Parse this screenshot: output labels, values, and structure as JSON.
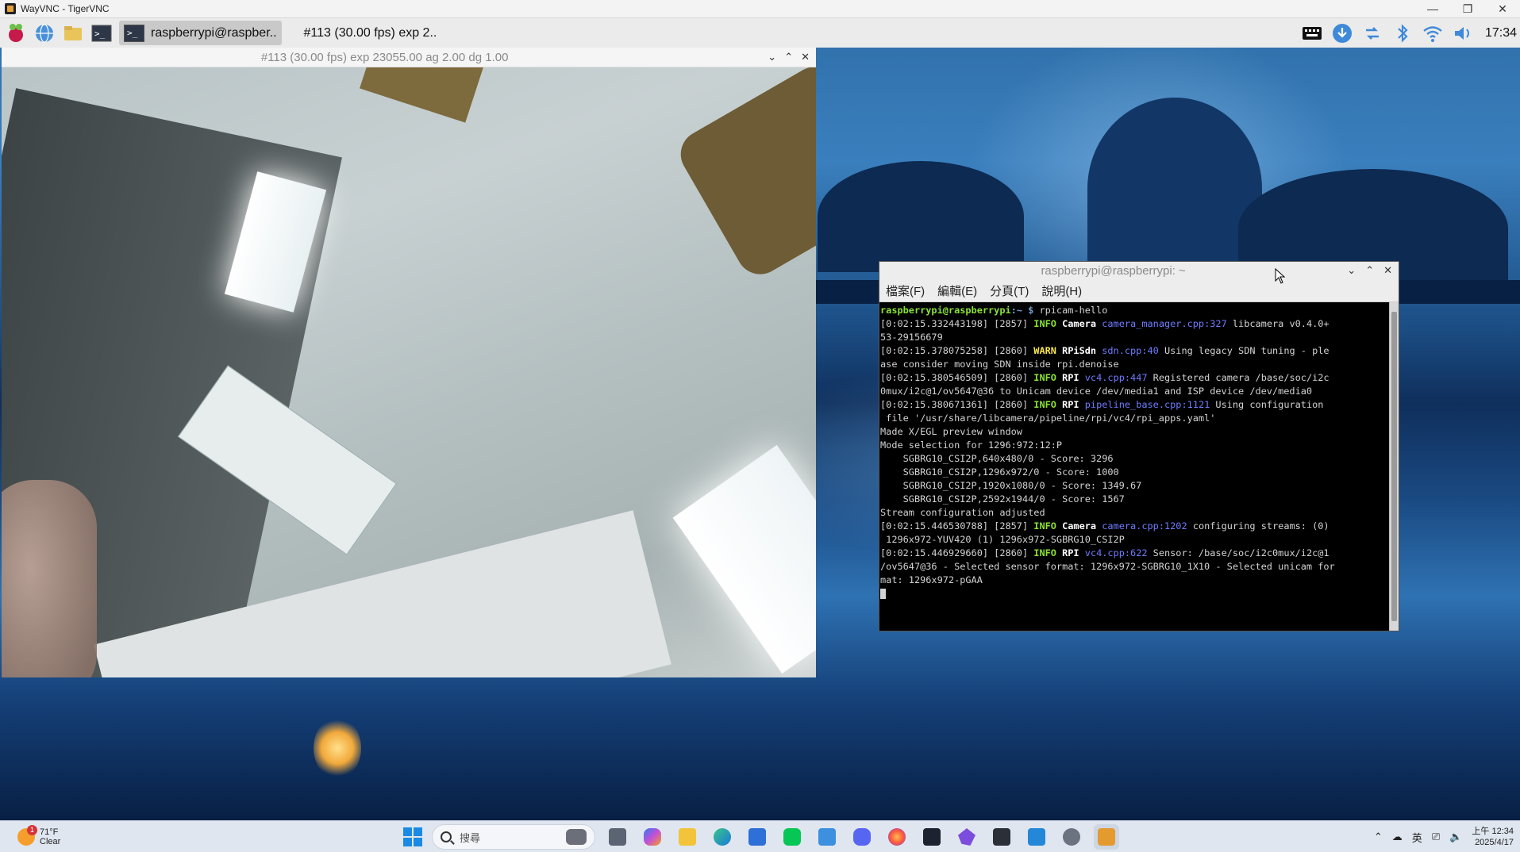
{
  "vnc_window": {
    "title": "WayVNC - TigerVNC",
    "minimize": "—",
    "restore": "❐",
    "close": "✕"
  },
  "rpi_panel": {
    "task_label": "raspberrypi@raspber..",
    "task2_label": "#113 (30.00 fps) exp 2..",
    "time": "17:34"
  },
  "preview": {
    "title": "#113 (30.00 fps) exp 23055.00 ag 2.00 dg 1.00",
    "min": "⌄",
    "max": "⌃",
    "close": "✕"
  },
  "terminal": {
    "title": "raspberrypi@raspberrypi: ~",
    "min": "⌄",
    "max": "⌃",
    "close": "✕",
    "menu": [
      "檔案(F)",
      "編輯(E)",
      "分頁(T)",
      "說明(H)"
    ],
    "prompt_user": "raspberrypi@raspberrypi",
    "prompt_path": ":~ $",
    "command": " rpicam-hello",
    "lines": [
      {
        "ts": "[0:02:15.332443198] [2857] ",
        "lvl": "INFO",
        "cat": "Camera",
        "src": "camera_manager.cpp:327",
        "msg": " libcamera v0.4.0+",
        "lvltype": "info"
      },
      {
        "plain": "53-29156679"
      },
      {
        "ts": "[0:02:15.378075258] [2860] ",
        "lvl": "WARN",
        "cat": "RPiSdn",
        "src": "sdn.cpp:40",
        "msg": " Using legacy SDN tuning - ple",
        "lvltype": "warn"
      },
      {
        "plain": "ase consider moving SDN inside rpi.denoise"
      },
      {
        "ts": "[0:02:15.380546509] [2860] ",
        "lvl": "INFO",
        "cat": "RPI",
        "src": "vc4.cpp:447",
        "msg": " Registered camera /base/soc/i2c",
        "lvltype": "info"
      },
      {
        "plain": "0mux/i2c@1/ov5647@36 to Unicam device /dev/media1 and ISP device /dev/media0"
      },
      {
        "ts": "[0:02:15.380671361] [2860] ",
        "lvl": "INFO",
        "cat": "RPI",
        "src": "pipeline_base.cpp:1121",
        "msg": " Using configuration",
        "lvltype": "info"
      },
      {
        "plain": " file '/usr/share/libcamera/pipeline/rpi/vc4/rpi_apps.yaml'"
      },
      {
        "plain": "Made X/EGL preview window"
      },
      {
        "plain": "Mode selection for 1296:972:12:P"
      },
      {
        "plain": "    SGBRG10_CSI2P,640x480/0 - Score: 3296"
      },
      {
        "plain": "    SGBRG10_CSI2P,1296x972/0 - Score: 1000"
      },
      {
        "plain": "    SGBRG10_CSI2P,1920x1080/0 - Score: 1349.67"
      },
      {
        "plain": "    SGBRG10_CSI2P,2592x1944/0 - Score: 1567"
      },
      {
        "plain": "Stream configuration adjusted"
      },
      {
        "ts": "[0:02:15.446530788] [2857] ",
        "lvl": "INFO",
        "cat": "Camera",
        "src": "camera.cpp:1202",
        "msg": " configuring streams: (0)",
        "lvltype": "info"
      },
      {
        "plain": " 1296x972-YUV420 (1) 1296x972-SGBRG10_CSI2P"
      },
      {
        "ts": "[0:02:15.446929660] [2860] ",
        "lvl": "INFO",
        "cat": "RPI",
        "src": "vc4.cpp:622",
        "msg": " Sensor: /base/soc/i2c0mux/i2c@1",
        "lvltype": "info"
      },
      {
        "plain": "/ov5647@36 - Selected sensor format: 1296x972-SGBRG10_1X10 - Selected unicam for"
      },
      {
        "plain": "mat: 1296x972-pGAA"
      }
    ]
  },
  "win_taskbar": {
    "temp": "71°F",
    "weather": "Clear",
    "badge": "1",
    "search_placeholder": "搜尋",
    "ime": "英",
    "time": "上午 12:34",
    "date": "2025/4/17"
  },
  "icons": {
    "rpi_menu": "raspberry-icon",
    "browser": "globe-icon",
    "files": "folder-icon",
    "terminal": "terminal-icon"
  }
}
